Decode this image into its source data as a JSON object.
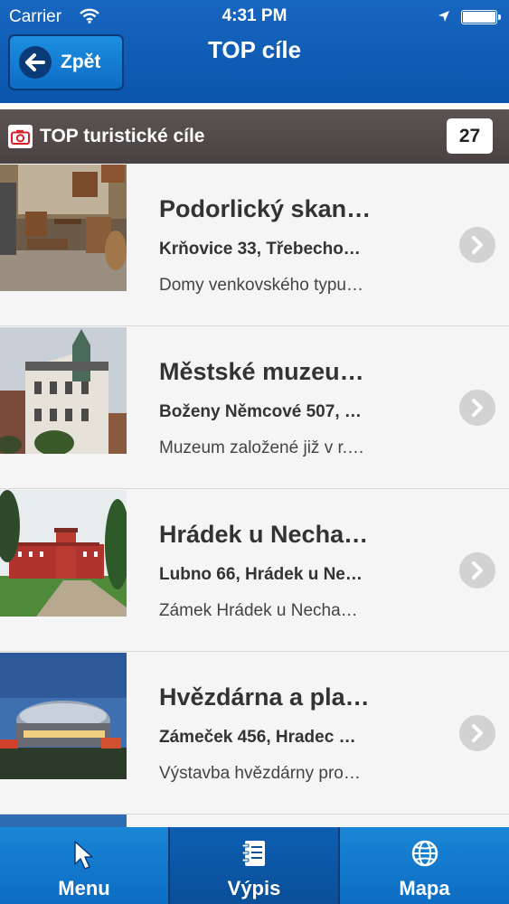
{
  "status_bar": {
    "carrier": "Carrier",
    "time": "4:31 PM"
  },
  "nav": {
    "back_label": "Zpět",
    "title": "TOP cíle"
  },
  "section": {
    "title": "TOP turistické cíle",
    "count": "27"
  },
  "items": [
    {
      "title": "Podorlický skan…",
      "address": "Krňovice 33, Třebecho…",
      "description": "Domy venkovského typu…"
    },
    {
      "title": "Městské muzeu…",
      "address": "Boženy Němcové 507, …",
      "description": "Muzeum založené již v r.…"
    },
    {
      "title": "Hrádek u Necha…",
      "address": "Lubno 66, Hrádek u Ne…",
      "description": "Zámek Hrádek u Necha…"
    },
    {
      "title": "Hvězdárna a pla…",
      "address": "Zámeček 456, Hradec …",
      "description": "Výstavba hvězdárny pro…"
    }
  ],
  "tabs": [
    {
      "label": "Menu",
      "icon": "cursor-icon"
    },
    {
      "label": "Výpis",
      "icon": "notebook-icon"
    },
    {
      "label": "Mapa",
      "icon": "globe-icon"
    }
  ],
  "colors": {
    "header": "#0b55ac",
    "section_bar": "#4f4747",
    "tab_bar": "#0c6cc2"
  }
}
